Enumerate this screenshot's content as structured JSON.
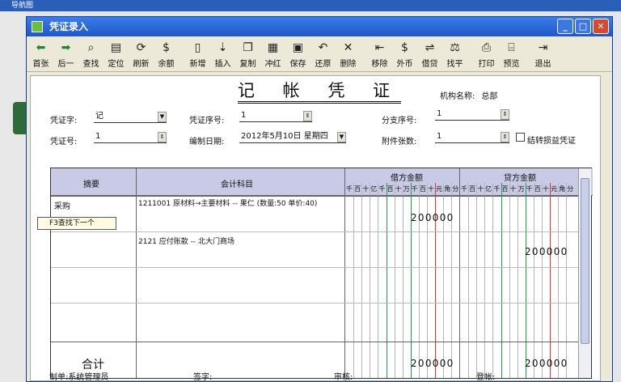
{
  "app_title": "导航图",
  "window": {
    "title": "凭证录入"
  },
  "toolbar": [
    {
      "icon": "arrow-left-icon",
      "label": "首张"
    },
    {
      "icon": "arrow-right-icon",
      "label": "后一"
    },
    {
      "icon": "find-icon",
      "label": "查找"
    },
    {
      "icon": "locate-icon",
      "label": "定位"
    },
    {
      "icon": "refresh-icon",
      "label": "刷新"
    },
    {
      "icon": "balance-icon",
      "label": "余额"
    },
    {
      "icon": "new-icon",
      "label": "新增"
    },
    {
      "icon": "insert-icon",
      "label": "插入"
    },
    {
      "icon": "copy-icon",
      "label": "复制"
    },
    {
      "icon": "reverse-icon",
      "label": "冲红"
    },
    {
      "icon": "save-icon",
      "label": "保存"
    },
    {
      "icon": "undo-icon",
      "label": "还原"
    },
    {
      "icon": "delete-icon",
      "label": "删除"
    },
    {
      "icon": "remove-icon",
      "label": "移除"
    },
    {
      "icon": "currency-icon",
      "label": "外币"
    },
    {
      "icon": "debit-credit-icon",
      "label": "借贷"
    },
    {
      "icon": "balance-check-icon",
      "label": "找平"
    },
    {
      "icon": "print-icon",
      "label": "打印"
    },
    {
      "icon": "preview-icon",
      "label": "预览"
    },
    {
      "icon": "exit-icon",
      "label": "退出"
    }
  ],
  "voucher": {
    "heading": "记 帐 凭 证",
    "org_label": "机构名称:",
    "org_value": "总部",
    "word_label": "凭证字:",
    "word_value": "记",
    "seq_label": "凭证序号:",
    "seq_value": "1",
    "branch_label": "分支序号:",
    "branch_value": "1",
    "no_label": "凭证号:",
    "no_value": "1",
    "date_label": "编制日期:",
    "date_value": "2012年5月10日 星期四",
    "attach_label": "附件张数:",
    "attach_value": "1",
    "carry_label": "结转损益凭证"
  },
  "grid": {
    "col_summary": "摘要",
    "col_account": "会计科目",
    "col_debit": "借方金额",
    "col_credit": "贷方金额",
    "digit_headers": [
      "千",
      "百",
      "十",
      "亿",
      "千",
      "百",
      "十",
      "万",
      "千",
      "百",
      "十",
      "元",
      "角",
      "分"
    ],
    "tooltip": "F3查找下一个",
    "rows": [
      {
        "summary": "采购",
        "account": "1211001 原材料→主要材料 -- 果仁 (数量:50 单价:40)",
        "debit": "200000",
        "credit": ""
      },
      {
        "summary": "",
        "account": "2121 应付账款 -- 北大门商场",
        "debit": "",
        "credit": "200000"
      },
      {
        "summary": "",
        "account": "",
        "debit": "",
        "credit": ""
      },
      {
        "summary": "",
        "account": "",
        "debit": "",
        "credit": ""
      }
    ],
    "total_label": "合计",
    "total_debit": "200000",
    "total_credit": "200000"
  },
  "footer": {
    "maker": "制单:系统管理员",
    "sign": "签字:",
    "audit": "审核:",
    "post": "登帐:"
  }
}
